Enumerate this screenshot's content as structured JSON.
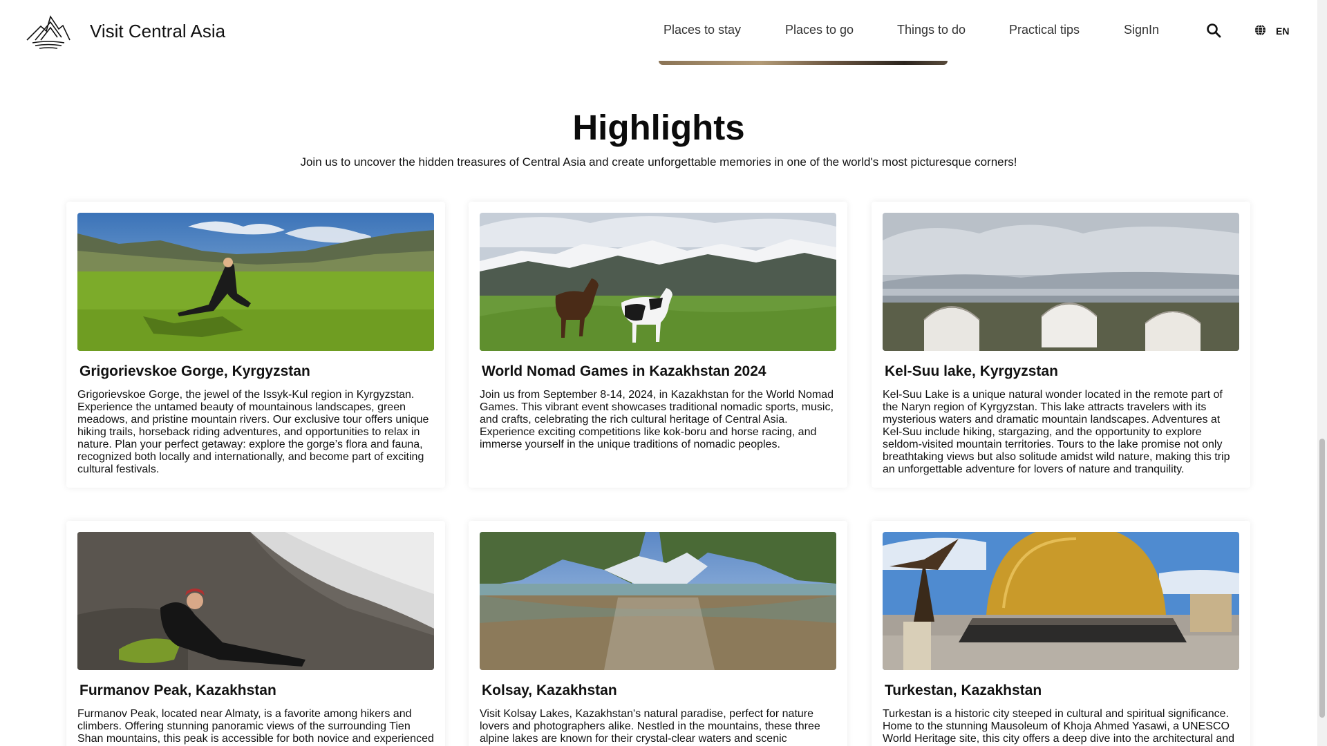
{
  "header": {
    "brand": "Visit Central Asia",
    "nav": [
      "Places to stay",
      "Places to go",
      "Things to do",
      "Practical tips",
      "SignIn"
    ],
    "language": "EN"
  },
  "section": {
    "title": "Highlights",
    "subtitle": "Join us to uncover the hidden treasures of Central Asia and create unforgettable memories in one of the world's most picturesque corners!"
  },
  "cards": [
    {
      "title": "Grigorievskoe Gorge, Kyrgyzstan",
      "text": "Grigorievskoe Gorge, the jewel of the Issyk-Kul region in Kyrgyzstan. Experience the untamed beauty of mountainous landscapes, green meadows, and pristine mountain rivers. Our exclusive tour offers unique hiking trails, horseback riding adventures, and opportunities to relax in nature. Plan your perfect getaway: explore the gorge’s flora and fauna, recognized both locally and internationally, and become part of exciting cultural festivals."
    },
    {
      "title": "World Nomad Games in Kazakhstan 2024",
      "text": "Join us from September 8-14, 2024, in Kazakhstan for the World Nomad Games. This vibrant event showcases traditional nomadic sports, music, and crafts, celebrating the rich cultural heritage of Central Asia. Experience exciting competitions like kok-boru and horse racing, and immerse yourself in the unique traditions of nomadic peoples."
    },
    {
      "title": "Kel-Suu lake, Kyrgyzstan",
      "text": "Kel-Suu Lake is a unique natural wonder located in the remote part of the Naryn region of Kyrgyzstan. This lake attracts travelers with its mysterious waters and dramatic mountain landscapes. Adventures at Kel-Suu include hiking, stargazing, and the opportunity to explore seldom-visited mountain territories. Tours to the lake promise not only breathtaking views but also solitude amidst wild nature, making this trip an unforgettable adventure for lovers of nature and tranquility."
    },
    {
      "title": "Furmanov Peak, Kazakhstan",
      "text": "Furmanov Peak, located near Almaty, is a favorite among hikers and climbers. Offering stunning panoramic views of the surrounding Tien Shan mountains, this peak is accessible for both novice and experienced"
    },
    {
      "title": "Kolsay, Kazakhstan",
      "text": "Visit Kolsay Lakes, Kazakhstan's natural paradise, perfect for nature lovers and photographers alike. Nestled in the mountains, these three alpine lakes are known for their crystal-clear waters and scenic"
    },
    {
      "title": "Turkestan, Kazakhstan",
      "text": "Turkestan is a historic city steeped in cultural and spiritual significance. Home to the stunning Mausoleum of Khoja Ahmed Yasawi, a UNESCO World Heritage site, this city offers a deep dive into the architectural and"
    }
  ]
}
